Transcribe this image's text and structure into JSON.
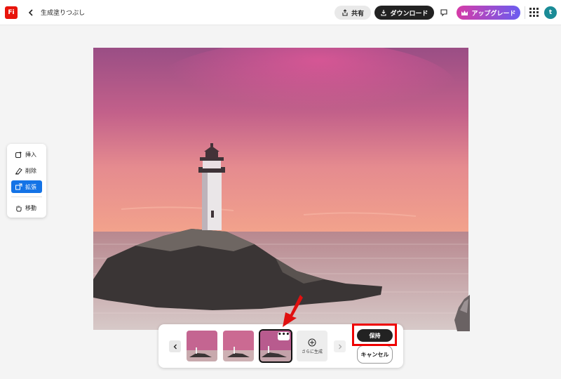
{
  "header": {
    "app_logo": "Fi",
    "title": "生成塗りつぶし",
    "share_label": "共有",
    "download_label": "ダウンロード",
    "upgrade_label": "アップグレード",
    "avatar_initial": "t"
  },
  "tools": {
    "items": [
      {
        "label": "挿入",
        "icon": "insert-icon"
      },
      {
        "label": "削除",
        "icon": "remove-icon"
      },
      {
        "label": "拡張",
        "icon": "expand-icon",
        "active": true
      },
      {
        "label": "移動",
        "icon": "hand-icon"
      }
    ]
  },
  "variations": {
    "thumbs": 3,
    "selected_index": 2,
    "more_menu": "•••",
    "generate_more_label": "さらに生成",
    "keep_label": "保持",
    "cancel_label": "キャンセル"
  },
  "colors": {
    "accent": "#1473e6",
    "brand": "#e8140b",
    "annotation": "#e00000",
    "upgrade_start": "#d63ba7",
    "upgrade_end": "#6a5cf0"
  }
}
